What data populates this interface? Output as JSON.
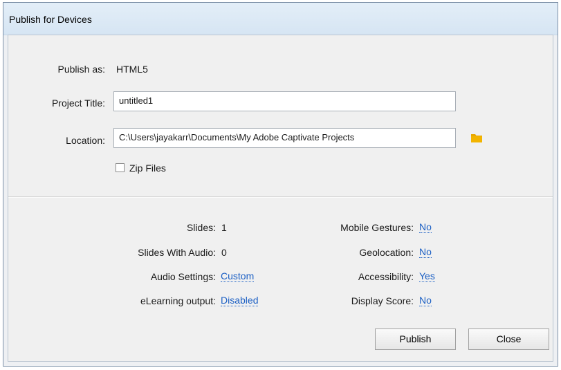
{
  "window": {
    "title": "Publish for Devices"
  },
  "publish_as": {
    "label": "Publish as:",
    "value": "HTML5"
  },
  "project_title": {
    "label": "Project Title:",
    "value": "untitled1"
  },
  "location": {
    "label": "Location:",
    "value": "C:\\Users\\jayakarr\\Documents\\My Adobe Captivate Projects",
    "browse_icon": "folder-icon"
  },
  "zip_files": {
    "label": "Zip Files",
    "checked": false
  },
  "stats_left": [
    {
      "label": "Slides:",
      "value": "1",
      "is_link": false
    },
    {
      "label": "Slides With Audio:",
      "value": "0",
      "is_link": false
    },
    {
      "label": "Audio Settings:",
      "value": "Custom",
      "is_link": true
    },
    {
      "label": "eLearning output:",
      "value": "Disabled",
      "is_link": true
    }
  ],
  "stats_right": [
    {
      "label": "Mobile Gestures:",
      "value": "No",
      "is_link": true
    },
    {
      "label": "Geolocation:",
      "value": "No",
      "is_link": true
    },
    {
      "label": "Accessibility:",
      "value": "Yes",
      "is_link": true
    },
    {
      "label": "Display Score:",
      "value": "No",
      "is_link": true
    }
  ],
  "buttons": {
    "publish": "Publish",
    "close": "Close"
  },
  "colors": {
    "link": "#1b5fc4",
    "folder": "#e8a800"
  }
}
